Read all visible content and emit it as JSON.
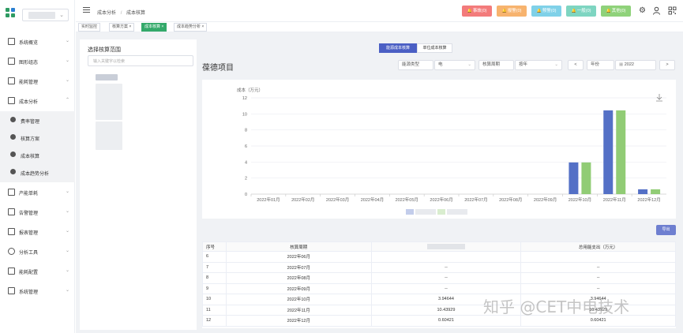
{
  "header": {
    "breadcrumb_1": "成本分析",
    "breadcrumb_sep": "/",
    "breadcrumb_2": "成本核算",
    "alerts": [
      {
        "label": "事故(0)",
        "color": "#f37b7b"
      },
      {
        "label": "报警(0)",
        "color": "#f7b36e"
      },
      {
        "label": "预警(0)",
        "color": "#7fd1e8"
      },
      {
        "label": "一般(0)",
        "color": "#7ed5c1"
      },
      {
        "label": "其他(0)",
        "color": "#8fd27a"
      }
    ]
  },
  "tabs": [
    {
      "label": "实时监控",
      "close": ""
    },
    {
      "label": "核算方案",
      "close": "×"
    },
    {
      "label": "成本核算",
      "close": "×"
    },
    {
      "label": "成本趋势分析",
      "close": "×"
    }
  ],
  "sidebar": {
    "items": [
      {
        "label": "系统概览"
      },
      {
        "label": "图形组态"
      },
      {
        "label": "能耗管理"
      },
      {
        "label": "成本分析"
      },
      {
        "label": "产能单耗"
      },
      {
        "label": "告警管理"
      },
      {
        "label": "报表管理"
      },
      {
        "label": "分析工具"
      },
      {
        "label": "能耗配置"
      },
      {
        "label": "系统管理"
      }
    ],
    "sub_items": [
      {
        "label": "费率管理"
      },
      {
        "label": "核算方案"
      },
      {
        "label": "成本核算"
      },
      {
        "label": "成本趋势分析"
      }
    ]
  },
  "left_panel": {
    "title": "选择核算范围",
    "search_placeholder": "输入关键字以检索"
  },
  "segments": {
    "option_1": "能源成本核算",
    "option_2": "单位成本核算"
  },
  "page_title": "葆德项目",
  "filters": {
    "energy_type_label": "能源类型",
    "energy_type_value": "电",
    "period_label": "核算周期",
    "period_value": "按年",
    "prev": "<",
    "year_label": "年份",
    "year_value": "2022",
    "next": ">"
  },
  "export_label": "导出",
  "table": {
    "headers": [
      "序号",
      "核算周期",
      "",
      "总用能支出（万元）"
    ],
    "rows": [
      [
        "6",
        "2022年06月",
        "",
        ""
      ],
      [
        "7",
        "2022年07月",
        "--",
        "--"
      ],
      [
        "8",
        "2022年08月",
        "--",
        "--"
      ],
      [
        "9",
        "2022年09月",
        "--",
        "--"
      ],
      [
        "10",
        "2022年10月",
        "3.94644",
        "3.94644"
      ],
      [
        "11",
        "2022年11月",
        "10.43929",
        "10.43929"
      ],
      [
        "12",
        "2022年12月",
        "0.60421",
        "0.60421"
      ]
    ]
  },
  "watermark": "知乎 @CET中电技术",
  "chart_data": {
    "type": "bar",
    "ylabel": "成本（万元）",
    "ylim": [
      0,
      12
    ],
    "yticks": [
      0,
      2,
      4,
      6,
      8,
      10,
      12
    ],
    "categories": [
      "2022年01月",
      "2022年02月",
      "2022年03月",
      "2022年04月",
      "2022年05月",
      "2022年06月",
      "2022年07月",
      "2022年08月",
      "2022年09月",
      "2022年10月",
      "2022年11月",
      "2022年12月"
    ],
    "series": [
      {
        "color": "#5470c6",
        "values": [
          0,
          0,
          0,
          0,
          0,
          0,
          0,
          0,
          0,
          3.95,
          10.44,
          0.6
        ]
      },
      {
        "color": "#91cc75",
        "values": [
          0,
          0,
          0,
          0,
          0,
          0,
          0,
          0,
          0,
          3.95,
          10.44,
          0.6
        ]
      }
    ],
    "grid": "horizontal",
    "legend": "bottom-center"
  }
}
